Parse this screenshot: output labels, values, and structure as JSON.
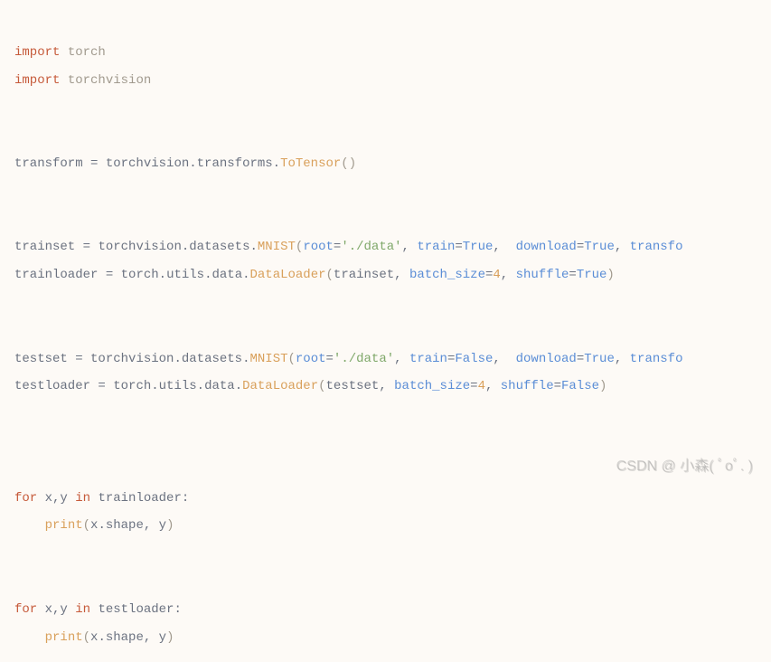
{
  "code": {
    "l1": {
      "kw1": "import",
      "mod1": "torch"
    },
    "l2": {
      "kw1": "import",
      "mod1": "torchvision"
    },
    "l4": {
      "lhs": "transform ",
      "eq": "= ",
      "p1": "torchvision",
      "dot1": ".",
      "p2": "transforms",
      "dot2": ".",
      "fn": "ToTensor",
      "op": "(",
      "cp": ")"
    },
    "l6": {
      "lhs": "trainset ",
      "eq": "= ",
      "p1": "torchvision",
      "dot1": ".",
      "p2": "datasets",
      "dot2": ".",
      "fn": "MNIST",
      "op": "(",
      "a1k": "root",
      "a1e": "=",
      "a1v": "'./data'",
      "c1": ", ",
      "a2k": "train",
      "a2e": "=",
      "a2v": "True",
      "c2": ",  ",
      "a3k": "download",
      "a3e": "=",
      "a3v": "True",
      "c3": ", ",
      "a4k": "transfo"
    },
    "l7": {
      "lhs": "trainloader ",
      "eq": "= ",
      "p1": "torch",
      "dot1": ".",
      "p2": "utils",
      "dot2": ".",
      "p3": "data",
      "dot3": ".",
      "fn": "DataLoader",
      "op": "(",
      "a1": "trainset",
      "c1": ", ",
      "a2k": "batch_size",
      "a2e": "=",
      "a2v": "4",
      "c2": ", ",
      "a3k": "shuffle",
      "a3e": "=",
      "a3v": "True",
      "cp": ")"
    },
    "l9": {
      "lhs": "testset ",
      "eq": "= ",
      "p1": "torchvision",
      "dot1": ".",
      "p2": "datasets",
      "dot2": ".",
      "fn": "MNIST",
      "op": "(",
      "a1k": "root",
      "a1e": "=",
      "a1v": "'./data'",
      "c1": ", ",
      "a2k": "train",
      "a2e": "=",
      "a2v": "False",
      "c2": ",  ",
      "a3k": "download",
      "a3e": "=",
      "a3v": "True",
      "c3": ", ",
      "a4k": "transfo"
    },
    "l10": {
      "lhs": "testloader ",
      "eq": "= ",
      "p1": "torch",
      "dot1": ".",
      "p2": "utils",
      "dot2": ".",
      "p3": "data",
      "dot3": ".",
      "fn": "DataLoader",
      "op": "(",
      "a1": "testset",
      "c1": ", ",
      "a2k": "batch_size",
      "a2e": "=",
      "a2v": "4",
      "c2": ", ",
      "a3k": "shuffle",
      "a3e": "=",
      "a3v": "False",
      "cp": ")"
    },
    "l13": {
      "kw": "for",
      "vars": " x,y ",
      "kin": "in",
      "it": " trainloader",
      "col": ":"
    },
    "l14": {
      "indent": "    ",
      "fn": "print",
      "op": "(",
      "p1": "x",
      "dot": ".",
      "p2": "shape",
      "c": ", ",
      "p3": "y",
      "cp": ")"
    },
    "l16": {
      "kw": "for",
      "vars": " x,y ",
      "kin": "in",
      "it": " testloader",
      "col": ":"
    },
    "l17": {
      "indent": "    ",
      "fn": "print",
      "op": "(",
      "p1": "x",
      "dot": ".",
      "p2": "shape",
      "c": ", ",
      "p3": "y",
      "cp": ")"
    }
  },
  "watermark": "CSDN @ 小森( ﾟoﾟ. )"
}
